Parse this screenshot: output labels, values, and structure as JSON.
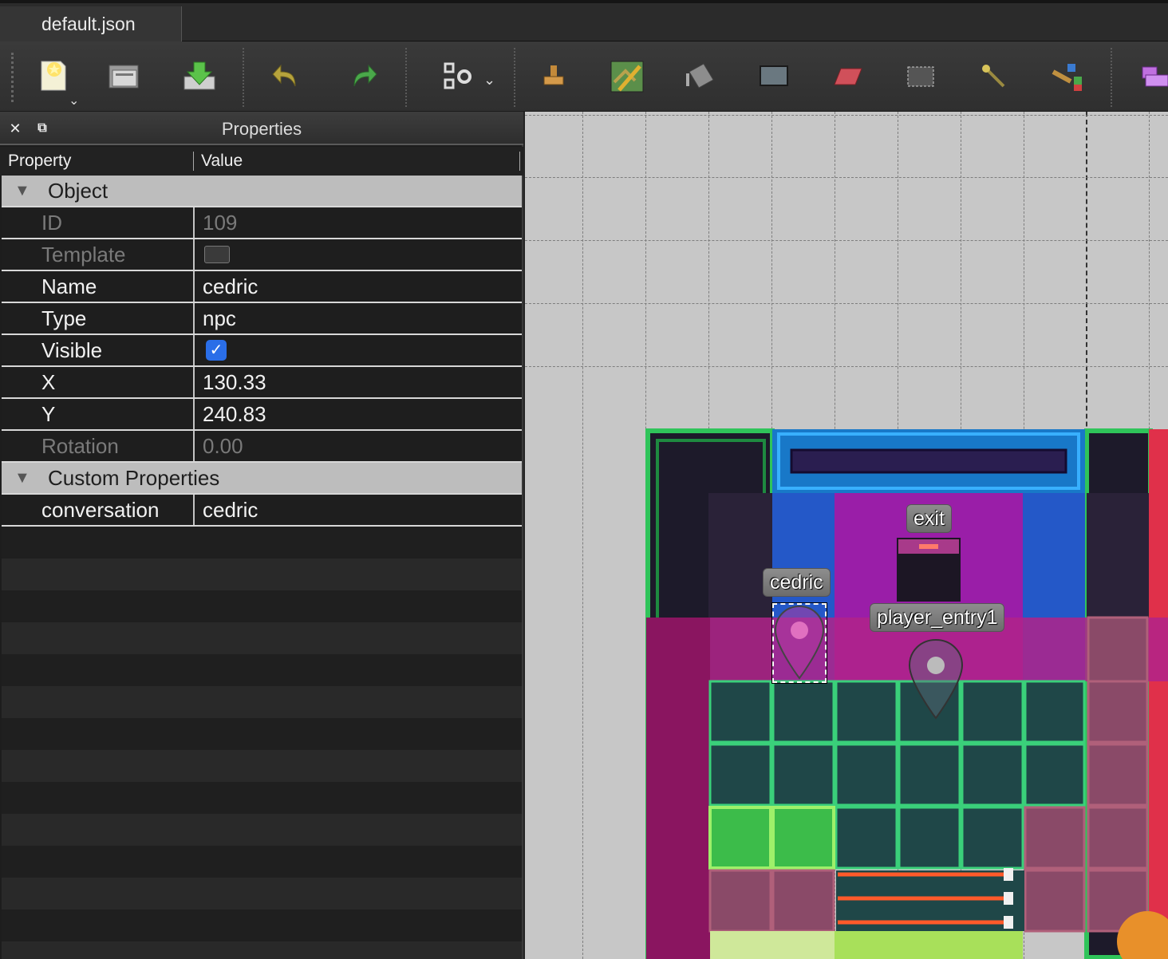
{
  "tab": {
    "title": "default.json"
  },
  "toolbar": {
    "items": [
      "new-map",
      "open",
      "save",
      "undo",
      "redo",
      "command-settings",
      "stamp-brush",
      "terrain-brush",
      "bucket-fill",
      "shape-fill",
      "eraser",
      "rect-select",
      "magic-wand",
      "select-same-tile",
      "object-select"
    ]
  },
  "properties": {
    "title": "Properties",
    "columns": {
      "property": "Property",
      "value": "Value"
    },
    "object_group": "Object",
    "id_label": "ID",
    "id_value": "109",
    "template_label": "Template",
    "name_label": "Name",
    "name_value": "cedric",
    "type_label": "Type",
    "type_value": "npc",
    "visible_label": "Visible",
    "visible_value": true,
    "x_label": "X",
    "x_value": "130.33",
    "y_label": "Y",
    "y_value": "240.83",
    "rotation_label": "Rotation",
    "rotation_value": "0.00",
    "custom_group": "Custom Properties",
    "conversation_label": "conversation",
    "conversation_value": "cedric"
  },
  "map": {
    "objects": [
      {
        "name": "exit"
      },
      {
        "name": "cedric"
      },
      {
        "name": "player_entry1"
      }
    ]
  }
}
